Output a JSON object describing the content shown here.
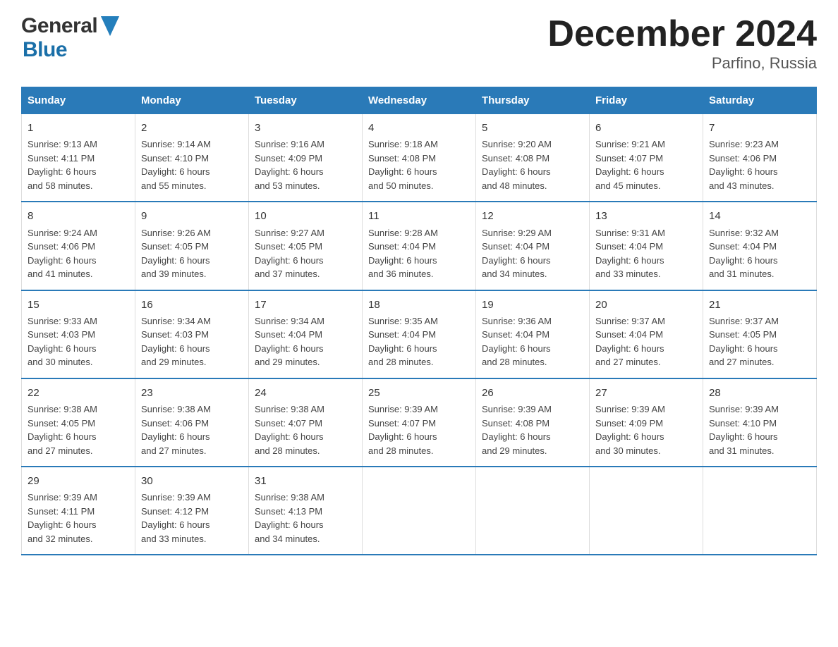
{
  "header": {
    "title": "December 2024",
    "subtitle": "Parfino, Russia",
    "logo_general": "General",
    "logo_blue": "Blue"
  },
  "calendar": {
    "days_of_week": [
      "Sunday",
      "Monday",
      "Tuesday",
      "Wednesday",
      "Thursday",
      "Friday",
      "Saturday"
    ],
    "weeks": [
      [
        {
          "day": "1",
          "sunrise": "9:13 AM",
          "sunset": "4:11 PM",
          "daylight": "6 hours and 58 minutes."
        },
        {
          "day": "2",
          "sunrise": "9:14 AM",
          "sunset": "4:10 PM",
          "daylight": "6 hours and 55 minutes."
        },
        {
          "day": "3",
          "sunrise": "9:16 AM",
          "sunset": "4:09 PM",
          "daylight": "6 hours and 53 minutes."
        },
        {
          "day": "4",
          "sunrise": "9:18 AM",
          "sunset": "4:08 PM",
          "daylight": "6 hours and 50 minutes."
        },
        {
          "day": "5",
          "sunrise": "9:20 AM",
          "sunset": "4:08 PM",
          "daylight": "6 hours and 48 minutes."
        },
        {
          "day": "6",
          "sunrise": "9:21 AM",
          "sunset": "4:07 PM",
          "daylight": "6 hours and 45 minutes."
        },
        {
          "day": "7",
          "sunrise": "9:23 AM",
          "sunset": "4:06 PM",
          "daylight": "6 hours and 43 minutes."
        }
      ],
      [
        {
          "day": "8",
          "sunrise": "9:24 AM",
          "sunset": "4:06 PM",
          "daylight": "6 hours and 41 minutes."
        },
        {
          "day": "9",
          "sunrise": "9:26 AM",
          "sunset": "4:05 PM",
          "daylight": "6 hours and 39 minutes."
        },
        {
          "day": "10",
          "sunrise": "9:27 AM",
          "sunset": "4:05 PM",
          "daylight": "6 hours and 37 minutes."
        },
        {
          "day": "11",
          "sunrise": "9:28 AM",
          "sunset": "4:04 PM",
          "daylight": "6 hours and 36 minutes."
        },
        {
          "day": "12",
          "sunrise": "9:29 AM",
          "sunset": "4:04 PM",
          "daylight": "6 hours and 34 minutes."
        },
        {
          "day": "13",
          "sunrise": "9:31 AM",
          "sunset": "4:04 PM",
          "daylight": "6 hours and 33 minutes."
        },
        {
          "day": "14",
          "sunrise": "9:32 AM",
          "sunset": "4:04 PM",
          "daylight": "6 hours and 31 minutes."
        }
      ],
      [
        {
          "day": "15",
          "sunrise": "9:33 AM",
          "sunset": "4:03 PM",
          "daylight": "6 hours and 30 minutes."
        },
        {
          "day": "16",
          "sunrise": "9:34 AM",
          "sunset": "4:03 PM",
          "daylight": "6 hours and 29 minutes."
        },
        {
          "day": "17",
          "sunrise": "9:34 AM",
          "sunset": "4:04 PM",
          "daylight": "6 hours and 29 minutes."
        },
        {
          "day": "18",
          "sunrise": "9:35 AM",
          "sunset": "4:04 PM",
          "daylight": "6 hours and 28 minutes."
        },
        {
          "day": "19",
          "sunrise": "9:36 AM",
          "sunset": "4:04 PM",
          "daylight": "6 hours and 28 minutes."
        },
        {
          "day": "20",
          "sunrise": "9:37 AM",
          "sunset": "4:04 PM",
          "daylight": "6 hours and 27 minutes."
        },
        {
          "day": "21",
          "sunrise": "9:37 AM",
          "sunset": "4:05 PM",
          "daylight": "6 hours and 27 minutes."
        }
      ],
      [
        {
          "day": "22",
          "sunrise": "9:38 AM",
          "sunset": "4:05 PM",
          "daylight": "6 hours and 27 minutes."
        },
        {
          "day": "23",
          "sunrise": "9:38 AM",
          "sunset": "4:06 PM",
          "daylight": "6 hours and 27 minutes."
        },
        {
          "day": "24",
          "sunrise": "9:38 AM",
          "sunset": "4:07 PM",
          "daylight": "6 hours and 28 minutes."
        },
        {
          "day": "25",
          "sunrise": "9:39 AM",
          "sunset": "4:07 PM",
          "daylight": "6 hours and 28 minutes."
        },
        {
          "day": "26",
          "sunrise": "9:39 AM",
          "sunset": "4:08 PM",
          "daylight": "6 hours and 29 minutes."
        },
        {
          "day": "27",
          "sunrise": "9:39 AM",
          "sunset": "4:09 PM",
          "daylight": "6 hours and 30 minutes."
        },
        {
          "day": "28",
          "sunrise": "9:39 AM",
          "sunset": "4:10 PM",
          "daylight": "6 hours and 31 minutes."
        }
      ],
      [
        {
          "day": "29",
          "sunrise": "9:39 AM",
          "sunset": "4:11 PM",
          "daylight": "6 hours and 32 minutes."
        },
        {
          "day": "30",
          "sunrise": "9:39 AM",
          "sunset": "4:12 PM",
          "daylight": "6 hours and 33 minutes."
        },
        {
          "day": "31",
          "sunrise": "9:38 AM",
          "sunset": "4:13 PM",
          "daylight": "6 hours and 34 minutes."
        },
        {
          "day": "",
          "sunrise": "",
          "sunset": "",
          "daylight": ""
        },
        {
          "day": "",
          "sunrise": "",
          "sunset": "",
          "daylight": ""
        },
        {
          "day": "",
          "sunrise": "",
          "sunset": "",
          "daylight": ""
        },
        {
          "day": "",
          "sunrise": "",
          "sunset": "",
          "daylight": ""
        }
      ]
    ],
    "labels": {
      "sunrise": "Sunrise:",
      "sunset": "Sunset:",
      "daylight": "Daylight:"
    }
  }
}
